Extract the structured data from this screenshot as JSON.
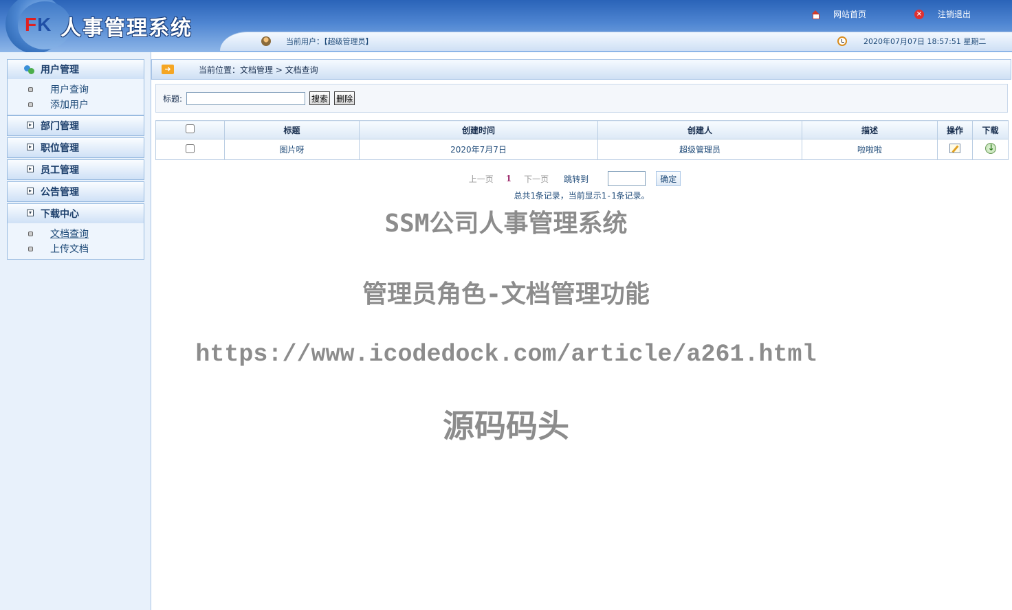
{
  "header": {
    "logo_letter_f": "F",
    "logo_letter_k": "K",
    "app_title": "人事管理系统",
    "links": [
      {
        "label": "网站首页",
        "icon": "home-icon"
      },
      {
        "label": "注销退出",
        "icon": "close-icon"
      }
    ],
    "current_user": "当前用户：【超级管理员】",
    "datetime": "2020年07月07日 18:57:51 星期二"
  },
  "sidebar": {
    "groups": [
      {
        "label": "用户管理",
        "expanded": true,
        "items": [
          "用户查询",
          "添加用户"
        ]
      },
      {
        "label": "部门管理",
        "expanded": false
      },
      {
        "label": "职位管理",
        "expanded": false
      },
      {
        "label": "员工管理",
        "expanded": false
      },
      {
        "label": "公告管理",
        "expanded": false
      },
      {
        "label": "下载中心",
        "expanded": true,
        "items": [
          "文档查询",
          "上传文档"
        ],
        "active_item": "文档查询"
      }
    ]
  },
  "main": {
    "breadcrumb": "当前位置：文档管理 > 文档查询",
    "search": {
      "label": "标题:",
      "value": "",
      "search_button": "搜索",
      "delete_button": "删除"
    },
    "table": {
      "headers": [
        "标题",
        "创建时间",
        "创建人",
        "描述",
        "操作",
        "下载"
      ],
      "rows": [
        {
          "title": "图片呀",
          "created": "2020年7月7日",
          "creator": "超级管理员",
          "desc": "啦啦啦"
        }
      ]
    },
    "pager": {
      "prev": "上一页",
      "current": "1",
      "next": "下一页",
      "jump_label": "跳转到",
      "jump_value": "",
      "ok_button": "确定",
      "summary": "总共1条记录，当前显示1-1条记录。"
    }
  },
  "watermark": {
    "line1": "SSM公司人事管理系统",
    "line2": "管理员角色-文档管理功能",
    "line3": "https://www.icodedock.com/article/a261.html",
    "line4": "源码码头"
  },
  "colors": {
    "header_top": "#2a63b8",
    "sidebar_bg": "#e8f1fb",
    "text_link": "#1e4a78",
    "pager_current": "#a03070"
  }
}
